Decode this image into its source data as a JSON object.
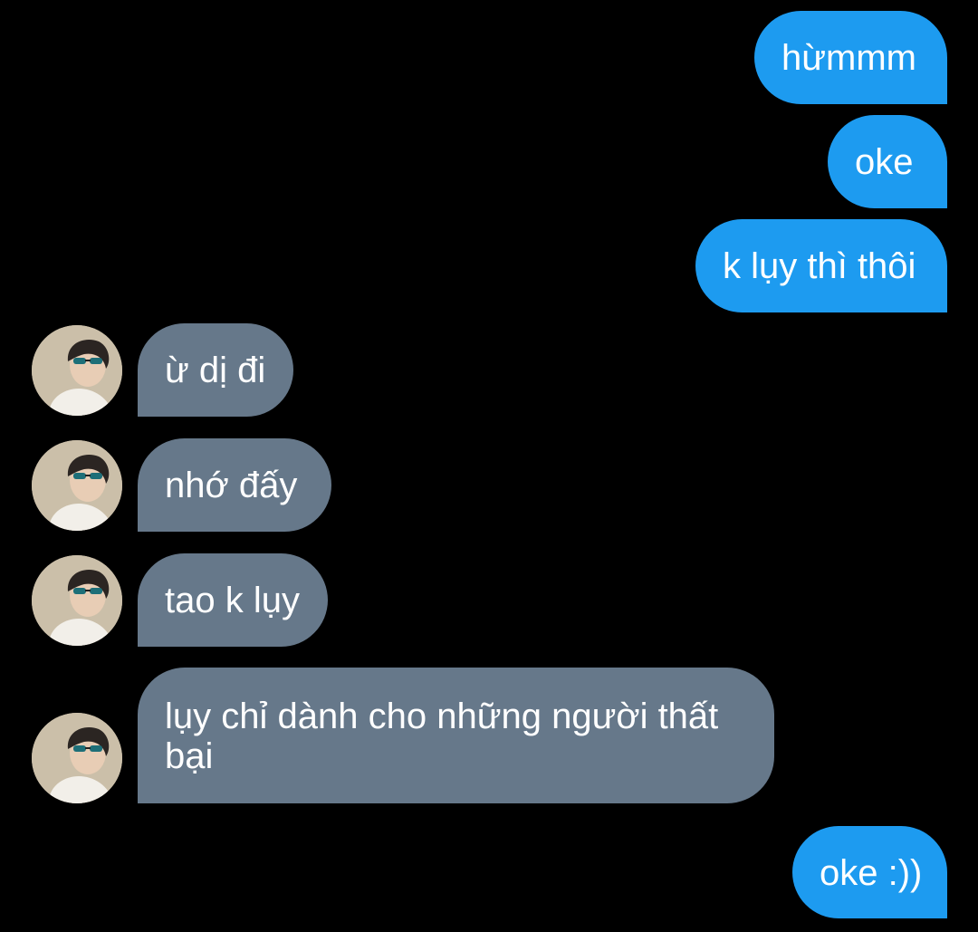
{
  "colors": {
    "background": "#000000",
    "outgoing_bubble": "#1d9bf0",
    "incoming_bubble": "#66788a",
    "text": "#ffffff"
  },
  "messages": [
    {
      "direction": "outgoing",
      "text": "hừmmm"
    },
    {
      "direction": "outgoing",
      "text": "oke"
    },
    {
      "direction": "outgoing",
      "text": "k lụy thì thôi"
    },
    {
      "direction": "incoming",
      "text": "ừ dị đi",
      "avatar_icon": "user-avatar-icon"
    },
    {
      "direction": "incoming",
      "text": "nhớ đấy",
      "avatar_icon": "user-avatar-icon"
    },
    {
      "direction": "incoming",
      "text": "tao k lụy",
      "avatar_icon": "user-avatar-icon"
    },
    {
      "direction": "incoming",
      "text": "lụy chỉ dành cho những người thất bại",
      "avatar_icon": "user-avatar-icon"
    },
    {
      "direction": "outgoing",
      "text": "oke :))"
    }
  ]
}
